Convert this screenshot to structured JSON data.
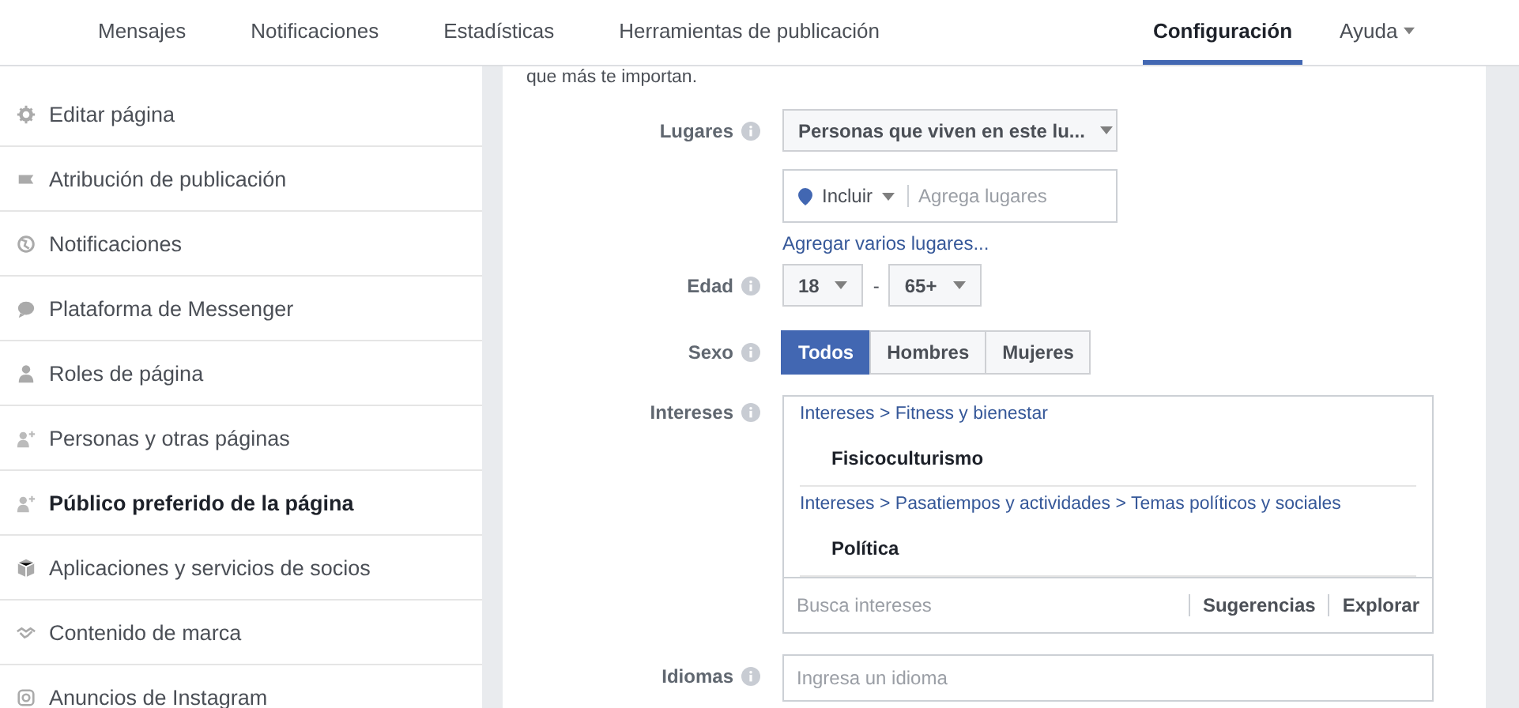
{
  "nav": {
    "tabs": [
      {
        "label": "Mensajes",
        "selected": false
      },
      {
        "label": "Notificaciones",
        "selected": false
      },
      {
        "label": "Estadísticas",
        "selected": false
      },
      {
        "label": "Herramientas de publicación",
        "selected": false
      },
      {
        "label": "Configuración",
        "selected": true
      },
      {
        "label": "Ayuda",
        "selected": false,
        "kind": "dropdown"
      }
    ]
  },
  "sidebar": {
    "items": [
      {
        "label": "Editar página",
        "selected": false
      },
      {
        "label": "Atribución de publicación",
        "selected": false
      },
      {
        "label": "Notificaciones",
        "selected": false
      },
      {
        "label": "Plataforma de Messenger",
        "selected": false
      },
      {
        "label": "Roles de página",
        "selected": false
      },
      {
        "label": "Personas y otras páginas",
        "selected": false
      },
      {
        "label": "Público preferido de la página",
        "selected": true
      },
      {
        "label": "Aplicaciones y servicios de socios",
        "selected": false
      },
      {
        "label": "Contenido de marca",
        "selected": false
      },
      {
        "label": "Anuncios de Instagram",
        "selected": false
      }
    ]
  },
  "form": {
    "intro": "que más te importan.",
    "places": {
      "label": "Lugares",
      "dropdown": "Personas que viven en este lu...",
      "include": "Incluir",
      "placeholder": "Agrega lugares",
      "link": "Agregar varios lugares..."
    },
    "age": {
      "label": "Edad",
      "from": "18",
      "separator": "-",
      "to": "65+"
    },
    "gender": {
      "label": "Sexo",
      "options": [
        {
          "label": "Todos",
          "selected": true
        },
        {
          "label": "Hombres",
          "selected": false
        },
        {
          "label": "Mujeres",
          "selected": false
        }
      ]
    },
    "interests": {
      "label": "Intereses",
      "items": [
        {
          "path": "Intereses > Fitness y bienestar",
          "name": "Fisicoculturismo"
        },
        {
          "path": "Intereses > Pasatiempos y actividades > Temas políticos y sociales",
          "name": "Política"
        }
      ],
      "placeholder": "Busca intereses",
      "suggestions": "Sugerencias",
      "explore": "Explorar"
    },
    "languages": {
      "label": "Idiomas",
      "placeholder": "Ingresa un idioma"
    }
  }
}
